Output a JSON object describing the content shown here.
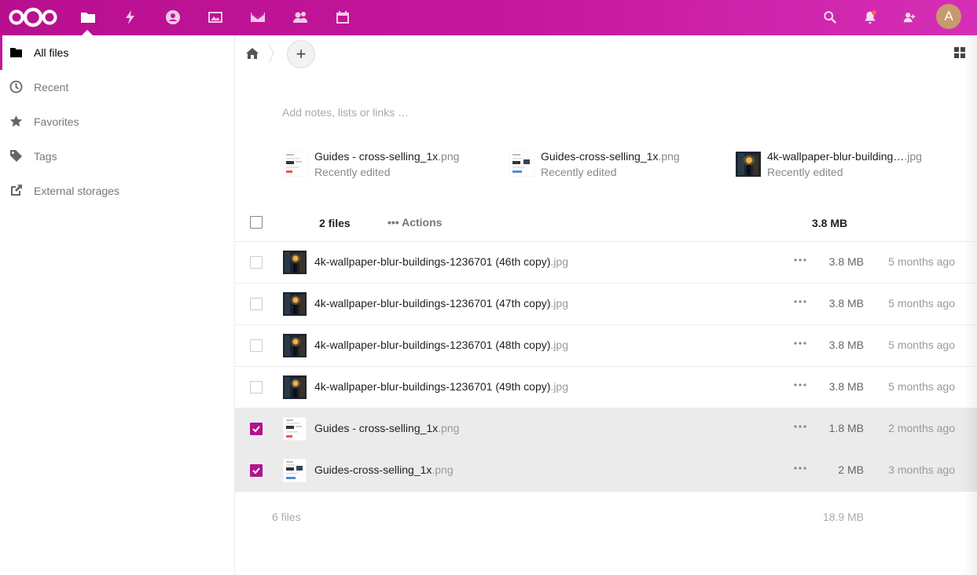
{
  "header": {
    "logo_icon": "nextcloud-logo-icon",
    "apps": [
      {
        "name": "files-icon",
        "active": true
      },
      {
        "name": "activity-icon",
        "active": false
      },
      {
        "name": "talk-icon",
        "active": false
      },
      {
        "name": "photos-icon",
        "active": false
      },
      {
        "name": "mail-icon",
        "active": false
      },
      {
        "name": "contacts-icon",
        "active": false
      },
      {
        "name": "calendar-icon",
        "active": false
      }
    ],
    "right_icons": [
      "search-icon",
      "notifications-icon",
      "contacts-menu-icon"
    ],
    "avatar_initial": "A",
    "brand_color": "#c1169a"
  },
  "sidebar": {
    "items": [
      {
        "label": "All files",
        "icon": "folder-icon",
        "active": true
      },
      {
        "label": "Recent",
        "icon": "clock-icon",
        "active": false
      },
      {
        "label": "Favorites",
        "icon": "star-icon",
        "active": false
      },
      {
        "label": "Tags",
        "icon": "tag-icon",
        "active": false
      },
      {
        "label": "External storages",
        "icon": "external-link-icon",
        "active": false
      }
    ]
  },
  "toolbar": {
    "home_icon": "home-icon",
    "new_label": "+",
    "view_toggle_icon": "grid-view-icon"
  },
  "notes": {
    "placeholder": "Add notes, lists or links …"
  },
  "recent": [
    {
      "base": "Guides - cross-selling_1x",
      "ext": ".png",
      "sub": "Recently edited",
      "thumb": "doc"
    },
    {
      "base": "Guides-cross-selling_1x",
      "ext": ".png",
      "sub": "Recently edited",
      "thumb": "doc"
    },
    {
      "base": "4k-wallpaper-blur-building…",
      "ext": ".jpg",
      "sub": "Recently edited",
      "thumb": "photo"
    }
  ],
  "table_header": {
    "count": "2 files",
    "actions": "Actions",
    "total_size": "3.8 MB"
  },
  "files": [
    {
      "base": "4k-wallpaper-blur-buildings-1236701 (46th copy)",
      "ext": ".jpg",
      "size": "3.8 MB",
      "modified": "5 months ago",
      "selected": false,
      "thumb": "photo"
    },
    {
      "base": "4k-wallpaper-blur-buildings-1236701 (47th copy)",
      "ext": ".jpg",
      "size": "3.8 MB",
      "modified": "5 months ago",
      "selected": false,
      "thumb": "photo"
    },
    {
      "base": "4k-wallpaper-blur-buildings-1236701 (48th copy)",
      "ext": ".jpg",
      "size": "3.8 MB",
      "modified": "5 months ago",
      "selected": false,
      "thumb": "photo"
    },
    {
      "base": "4k-wallpaper-blur-buildings-1236701 (49th copy)",
      "ext": ".jpg",
      "size": "3.8 MB",
      "modified": "5 months ago",
      "selected": false,
      "thumb": "photo"
    },
    {
      "base": "Guides - cross-selling_1x",
      "ext": ".png",
      "size": "1.8 MB",
      "modified": "2 months ago",
      "selected": true,
      "thumb": "doc"
    },
    {
      "base": "Guides-cross-selling_1x",
      "ext": ".png",
      "size": "2 MB",
      "modified": "3 months ago",
      "selected": true,
      "thumb": "doc"
    }
  ],
  "footer": {
    "count": "6 files",
    "total_size": "18.9 MB"
  }
}
